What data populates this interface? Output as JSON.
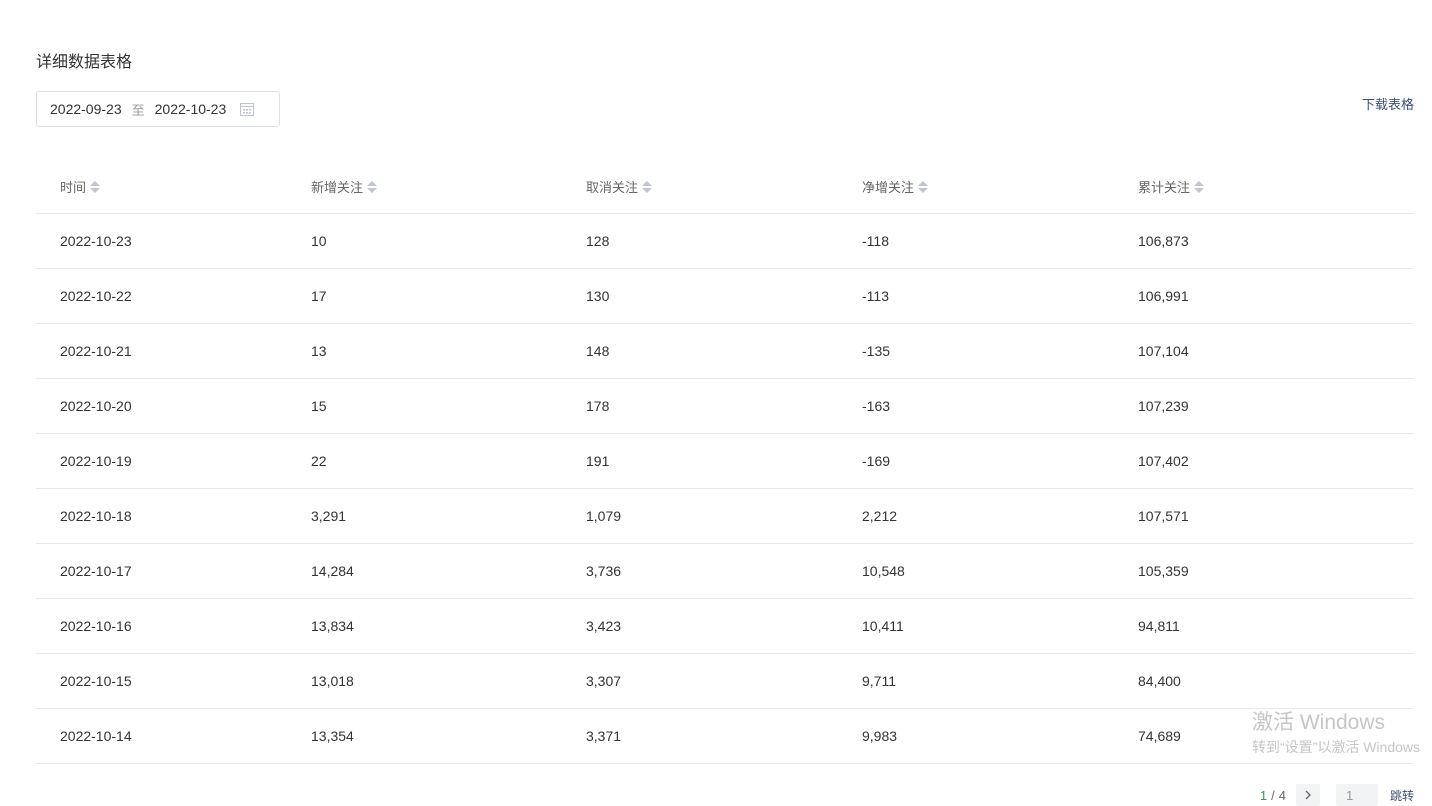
{
  "section": {
    "title": "详细数据表格"
  },
  "date_range": {
    "start": "2022-09-23",
    "separator": "至",
    "end": "2022-10-23"
  },
  "download_label": "下载表格",
  "table": {
    "columns": [
      "时间",
      "新增关注",
      "取消关注",
      "净增关注",
      "累计关注"
    ],
    "rows": [
      [
        "2022-10-23",
        "10",
        "128",
        "-118",
        "106,873"
      ],
      [
        "2022-10-22",
        "17",
        "130",
        "-113",
        "106,991"
      ],
      [
        "2022-10-21",
        "13",
        "148",
        "-135",
        "107,104"
      ],
      [
        "2022-10-20",
        "15",
        "178",
        "-163",
        "107,239"
      ],
      [
        "2022-10-19",
        "22",
        "191",
        "-169",
        "107,402"
      ],
      [
        "2022-10-18",
        "3,291",
        "1,079",
        "2,212",
        "107,571"
      ],
      [
        "2022-10-17",
        "14,284",
        "3,736",
        "10,548",
        "105,359"
      ],
      [
        "2022-10-16",
        "13,834",
        "3,423",
        "10,411",
        "94,811"
      ],
      [
        "2022-10-15",
        "13,018",
        "3,307",
        "9,711",
        "84,400"
      ],
      [
        "2022-10-14",
        "13,354",
        "3,371",
        "9,983",
        "74,689"
      ]
    ]
  },
  "pagination": {
    "current": "1",
    "separator": "/",
    "total": "4",
    "jump_value": "1",
    "jump_label": "跳转"
  },
  "watermark": {
    "line1": "激活 Windows",
    "line2": "转到“设置”以激活 Windows"
  },
  "colors": {
    "accent_green": "#2e9e5b",
    "link": "#3e4f73",
    "border": "#e8e8e8"
  }
}
